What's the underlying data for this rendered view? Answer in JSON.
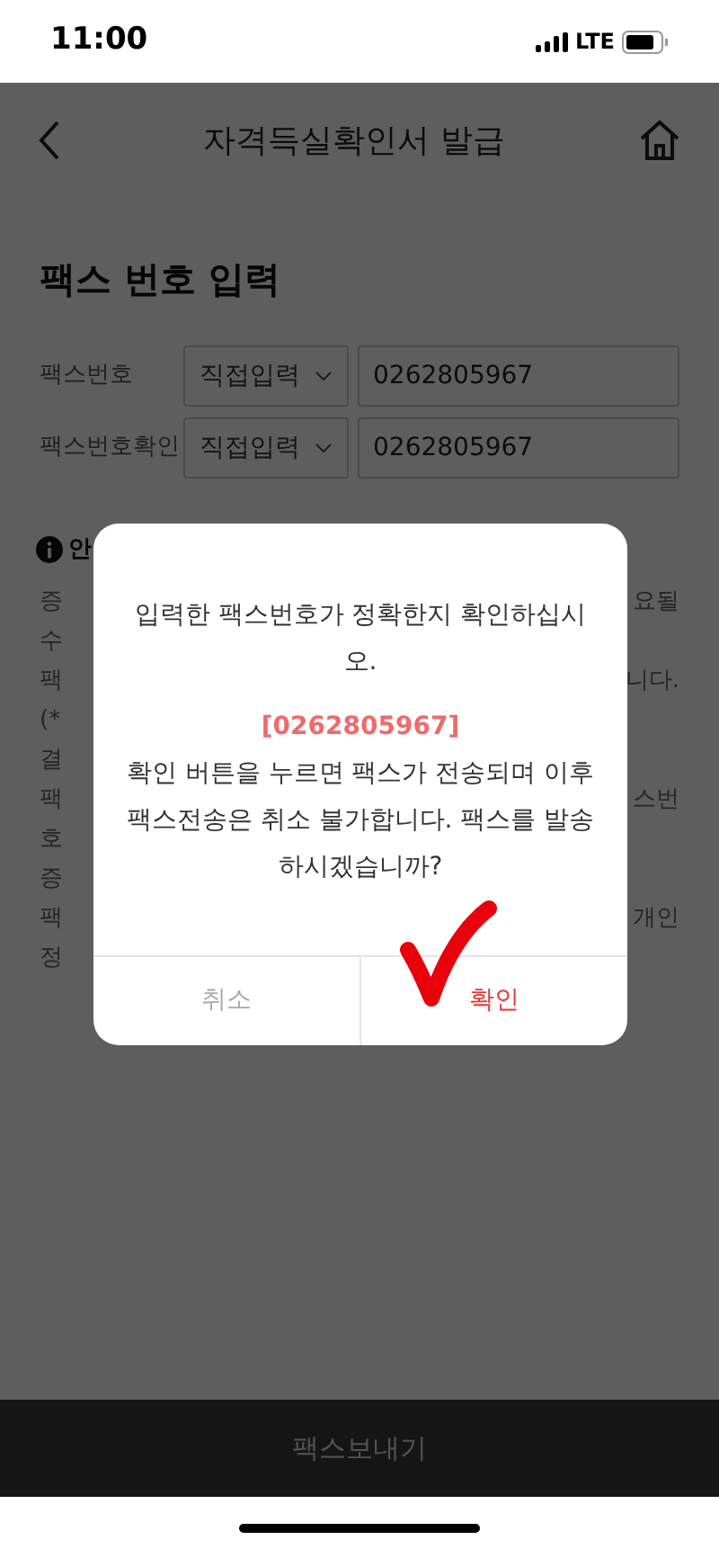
{
  "status_bar": {
    "time": "11:00",
    "network": "LTE"
  },
  "header": {
    "title": "자격득실확인서 발급"
  },
  "section": {
    "title": "팩스 번호 입력",
    "fields": [
      {
        "label": "팩스번호",
        "select": "직접입력",
        "value": "0262805967"
      },
      {
        "label": "팩스번호확인",
        "select": "직접입력",
        "value": "0262805967"
      }
    ]
  },
  "notice": {
    "title": "안",
    "lines": [
      {
        "left": "증",
        "right": "요될"
      },
      {
        "left": "수"
      },
      {
        "left": "팩",
        "right": "니다."
      },
      {
        "left": "(*"
      },
      {
        "left": "결"
      },
      {
        "left": "팩",
        "right": "스번"
      },
      {
        "left": "호"
      },
      {
        "left": "증"
      },
      {
        "left": "팩",
        "right": "개인"
      },
      {
        "left": "정"
      }
    ]
  },
  "dialog": {
    "message": "입력한 팩스번호가 정확한지 확인하십시오.",
    "number": "[0262805967]",
    "detail": "확인 버튼을 누르면 팩스가 전송되며 이후 팩스전송은 취소 불가합니다. 팩스를 발송하시겠습니까?",
    "buttons": [
      {
        "label": "취소",
        "kind": "cancel"
      },
      {
        "label": "확인",
        "kind": "confirm"
      }
    ]
  },
  "bottom_button": {
    "label": "팩스보내기"
  }
}
